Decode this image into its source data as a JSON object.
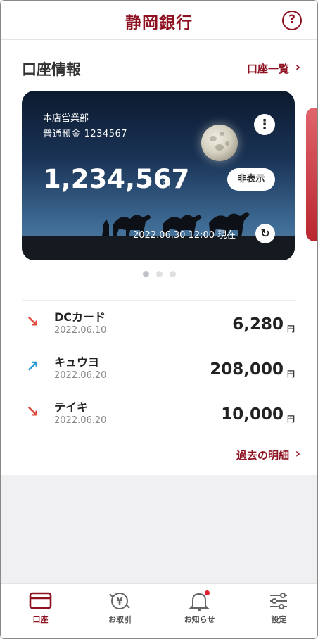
{
  "header": {
    "title": "静岡銀行",
    "help_icon": "help-icon",
    "help_glyph": "?"
  },
  "section": {
    "title": "口座情報",
    "list_link": "口座一覧",
    "chevron": "›"
  },
  "card": {
    "branch": "本店営業部",
    "account": "普通預金 1234567",
    "balance": "1,234,567",
    "currency": "円",
    "hide_label": "非表示",
    "menu_glyph": "⋮",
    "as_of": "2022.06.30 12:00 現在",
    "refresh_glyph": "↻"
  },
  "carousel": {
    "pages": 3,
    "active": 0
  },
  "transactions": [
    {
      "name": "DCカード",
      "date": "2022.06.10",
      "amount": "6,280",
      "unit": "円",
      "direction": "out",
      "arrow": "↘",
      "color": "#e0483e"
    },
    {
      "name": "キュウヨ",
      "date": "2022.06.20",
      "amount": "208,000",
      "unit": "円",
      "direction": "in",
      "arrow": "↗",
      "color": "#2a9bd6"
    },
    {
      "name": "テイキ",
      "date": "2022.06.20",
      "amount": "10,000",
      "unit": "円",
      "direction": "out",
      "arrow": "↘",
      "color": "#e0483e"
    }
  ],
  "history_link": "過去の明細",
  "tabbar": [
    {
      "label": "口座",
      "icon": "card-icon",
      "active": true
    },
    {
      "label": "お取引",
      "icon": "exchange-icon",
      "active": false
    },
    {
      "label": "お知らせ",
      "icon": "bell-icon",
      "active": false,
      "badge": true
    },
    {
      "label": "設定",
      "icon": "settings-icon",
      "active": false
    }
  ],
  "colors": {
    "brand": "#8f1222",
    "badge": "#e2232f"
  }
}
